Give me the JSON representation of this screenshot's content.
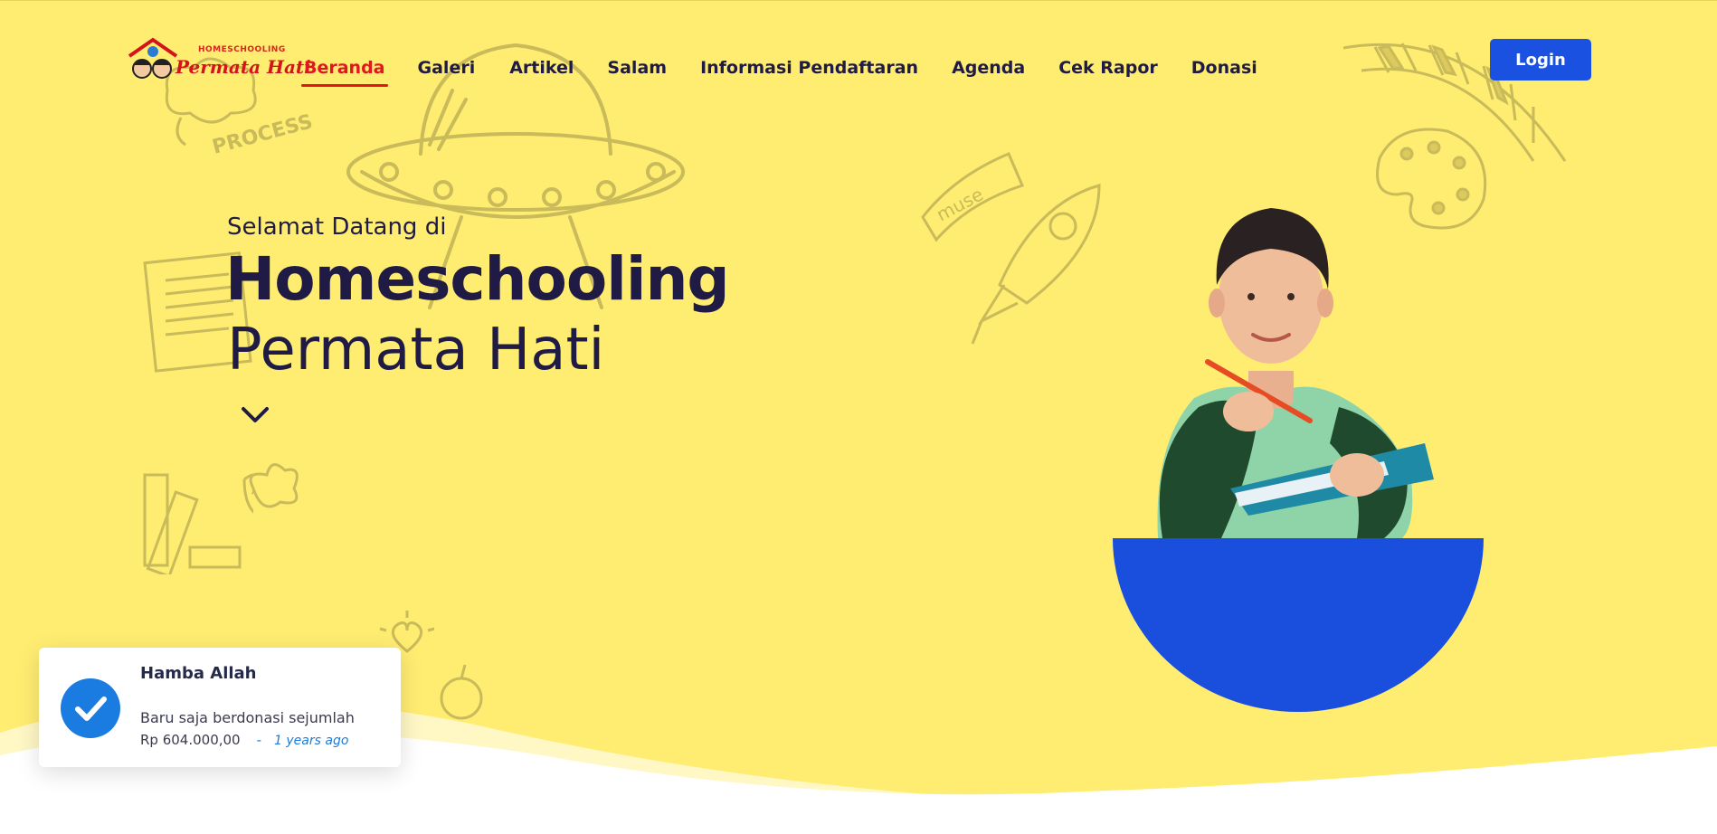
{
  "brand": {
    "logo_small_text": "HOMESCHOOLING",
    "logo_main_text": "Permata Hati"
  },
  "nav": {
    "items": [
      {
        "label": "Beranda",
        "active": true
      },
      {
        "label": "Galeri"
      },
      {
        "label": "Artikel"
      },
      {
        "label": "Salam"
      },
      {
        "label": "Informasi Pendaftaran"
      },
      {
        "label": "Agenda"
      },
      {
        "label": "Cek Rapor"
      },
      {
        "label": "Donasi"
      }
    ],
    "login_label": "Login"
  },
  "hero": {
    "welcome": "Selamat Datang di",
    "title_line1": "Homeschooling",
    "title_line2": "Permata Hati",
    "scroll_icon": "chevron-down-icon",
    "doodle_text_process": "PROCESS",
    "doodle_text_muse": "muse"
  },
  "toast": {
    "name": "Hamba Allah",
    "message": "Baru saja berdonasi sejumlah",
    "amount": "Rp 604.000,00",
    "separator": "-",
    "time": "1 years ago",
    "icon": "check-circle-icon"
  },
  "colors": {
    "background": "#ffed72",
    "primary": "#1a51e0",
    "active_nav": "#e0171f",
    "text_dark": "#1f1b45",
    "accent_blue": "#1a7be0"
  }
}
